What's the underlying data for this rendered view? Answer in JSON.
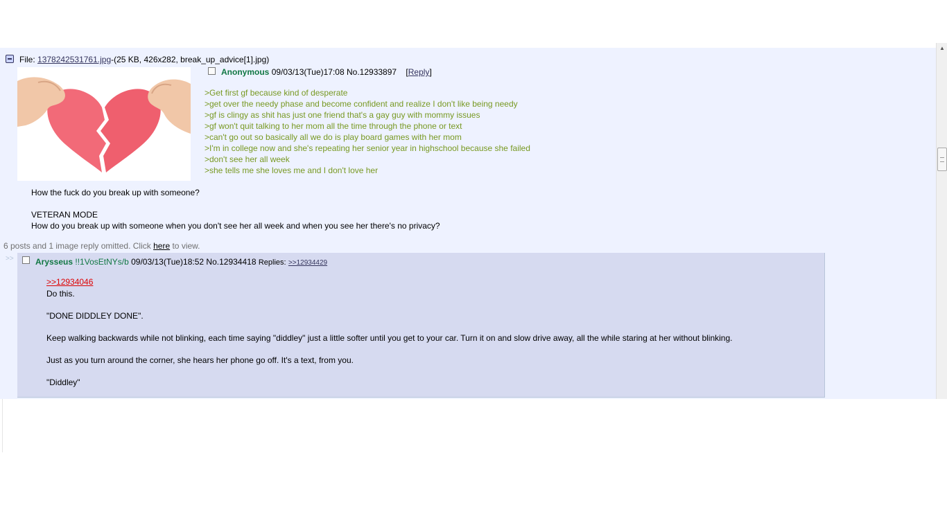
{
  "op": {
    "file_label": "File: ",
    "file_name": "1378242531761.jpg",
    "file_meta": "-(25 KB, 426x282, break_up_advice[1].jpg)",
    "name": "Anonymous",
    "datetime": "09/03/13(Tue)17:08",
    "post_no": "No.12933897",
    "reply_open": "[",
    "reply_label": "Reply",
    "reply_close": "]",
    "greentext": [
      ">Get first gf because kind of desperate",
      ">get over the needy phase and become confident and realize I don't like being needy",
      ">gf is clingy as shit has just one friend that's a gay guy with mommy issues",
      ">gf won't quit talking to her mom all the time through the phone or text",
      ">can't go out so basically all we do is play board games with her mom",
      ">I'm in college now and she's repeating her senior year in highschool because she failed",
      ">don't see her all week",
      ">she tells me she loves me and I don't love her"
    ],
    "question": "How the fuck do you break up with someone?",
    "veteran": "VETERAN MODE",
    "question2": "How do you break up with someone when you don't see her all week and when you see her there's no privacy?"
  },
  "omitted": {
    "text_before": "6 posts and 1 image reply omitted. Click ",
    "link": "here",
    "text_after": " to view."
  },
  "reply": {
    "arrows": ">>",
    "name": "Arysseus",
    "trip": " !!1VosEtNYs/b",
    "datetime": "09/03/13(Tue)18:52",
    "post_no": "No.12934418",
    "replies_label": "Replies:",
    "replies_link": ">>12934429",
    "quote": ">>12934046",
    "lines": [
      "Do this.",
      "\"DONE DIDDLEY DONE\".",
      "Keep walking backwards while not blinking, each time saying \"diddley\" just a little softer until you get to your car. Turn it on and slow drive away, all the while staring at her without blinking.",
      "Just as you turn around the corner, she hears her phone go off. It's a text, from you.",
      "\"Diddley\""
    ]
  },
  "colors": {
    "background": "#eef2ff",
    "reply_bg": "#d6daf0",
    "name": "#117743",
    "greentext": "#789922",
    "quotelink": "#dd0000",
    "link": "#34345c"
  }
}
